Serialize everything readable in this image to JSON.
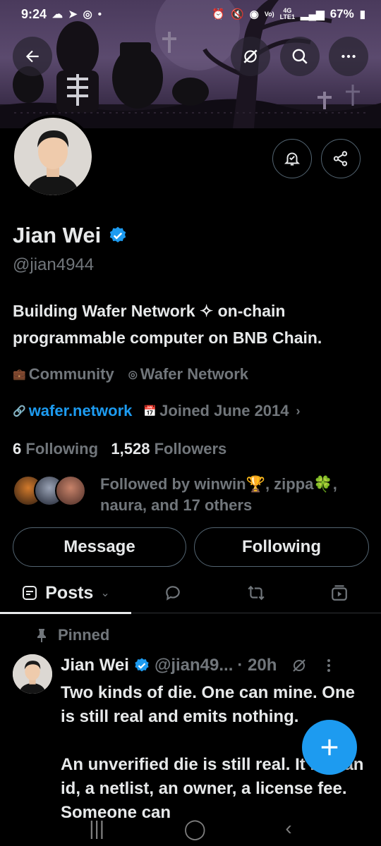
{
  "status_bar": {
    "time": "9:24",
    "battery": "67%",
    "network_top": "4G",
    "network_bottom": "LTE1",
    "volte": "Vo)"
  },
  "profile": {
    "name": "Jian Wei",
    "handle": "@jian4944",
    "bio": "Building Wafer Network ✧ on-chain programmable computer on BNB Chain.",
    "category": "Community",
    "location": "Wafer Network",
    "website": "wafer.network",
    "joined": "Joined June 2014",
    "following_count": "6",
    "following_label": "Following",
    "followers_count": "1,528",
    "followers_label": "Followers",
    "followed_by": "Followed by winwin🏆, zippa🍀, naura, and 17 others"
  },
  "actions": {
    "message_label": "Message",
    "following_label": "Following"
  },
  "tabs": {
    "posts_label": "Posts"
  },
  "pinned_post": {
    "pinned_label": "Pinned",
    "author": "Jian Wei",
    "handle": "@jian49...",
    "time": "· 20h",
    "paragraph1": "Two kinds of die. One can mine. One is still real and emits nothing.",
    "paragraph2": "An unverified die is still real. It has an id, a netlist, an owner, a license fee. Someone can"
  },
  "colors": {
    "accent": "#1d9bf0",
    "background": "#000000",
    "text_primary": "#e7e9ea",
    "text_secondary": "#71767b"
  }
}
